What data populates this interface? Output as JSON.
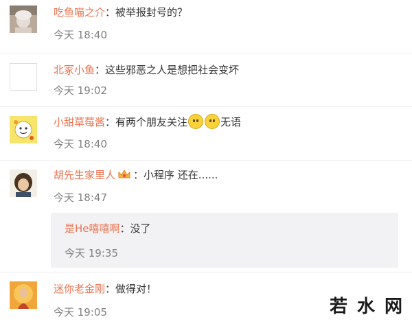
{
  "comments": [
    {
      "user": "吃鱼喵之介",
      "sep": "：",
      "text": "被举报封号的？",
      "time": "今天 18:40"
    },
    {
      "user": "北冢小鱼",
      "sep": "：",
      "text": "这些邪恶之人是想把社会变坏",
      "time": "今天 19:02"
    },
    {
      "user": "小甜草莓酱",
      "sep": "：",
      "text_before": "有两个朋友关注",
      "text_after": "无语",
      "time": "今天 18:40"
    },
    {
      "user": "胡先生家里人",
      "sep": "：",
      "text": "小程序 还在......",
      "time": "今天 18:47"
    },
    {
      "user": "迷你老金刚",
      "sep": "：",
      "text": "做得对！",
      "time": "今天 19:05"
    }
  ],
  "reply": {
    "user": "是He嘻嘻啊",
    "sep": "：",
    "text": "没了",
    "time": "今天 19:35"
  },
  "icons": {
    "emoji": "grin-emoji-icon",
    "badge": "crown-badge-icon"
  },
  "watermark": {
    "text": "若水网"
  },
  "colors": {
    "username": "#eb7350",
    "time": "#808080",
    "reply_bg": "#f2f2f5"
  }
}
